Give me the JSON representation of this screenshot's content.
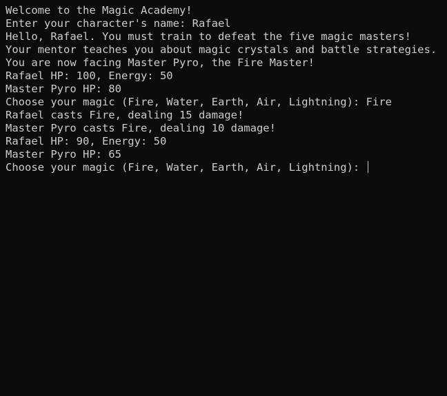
{
  "terminal": {
    "lines": [
      "Welcome to the Magic Academy!",
      "Enter your character's name: Rafael",
      "Hello, Rafael. You must train to defeat the five magic masters!",
      "Your mentor teaches you about magic crystals and battle strategies.",
      "You are now facing Master Pyro, the Fire Master!",
      "Rafael HP: 100, Energy: 50",
      "Master Pyro HP: 80",
      "Choose your magic (Fire, Water, Earth, Air, Lightning): Fire",
      "Rafael casts Fire, dealing 15 damage!",
      "Master Pyro casts Fire, dealing 10 damage!",
      "Rafael HP: 90, Energy: 50",
      "Master Pyro HP: 65"
    ],
    "prompt": "Choose your magic (Fire, Water, Earth, Air, Lightning): ",
    "input_value": ""
  },
  "colors": {
    "background": "#0c0c0c",
    "text": "#cccccc"
  }
}
